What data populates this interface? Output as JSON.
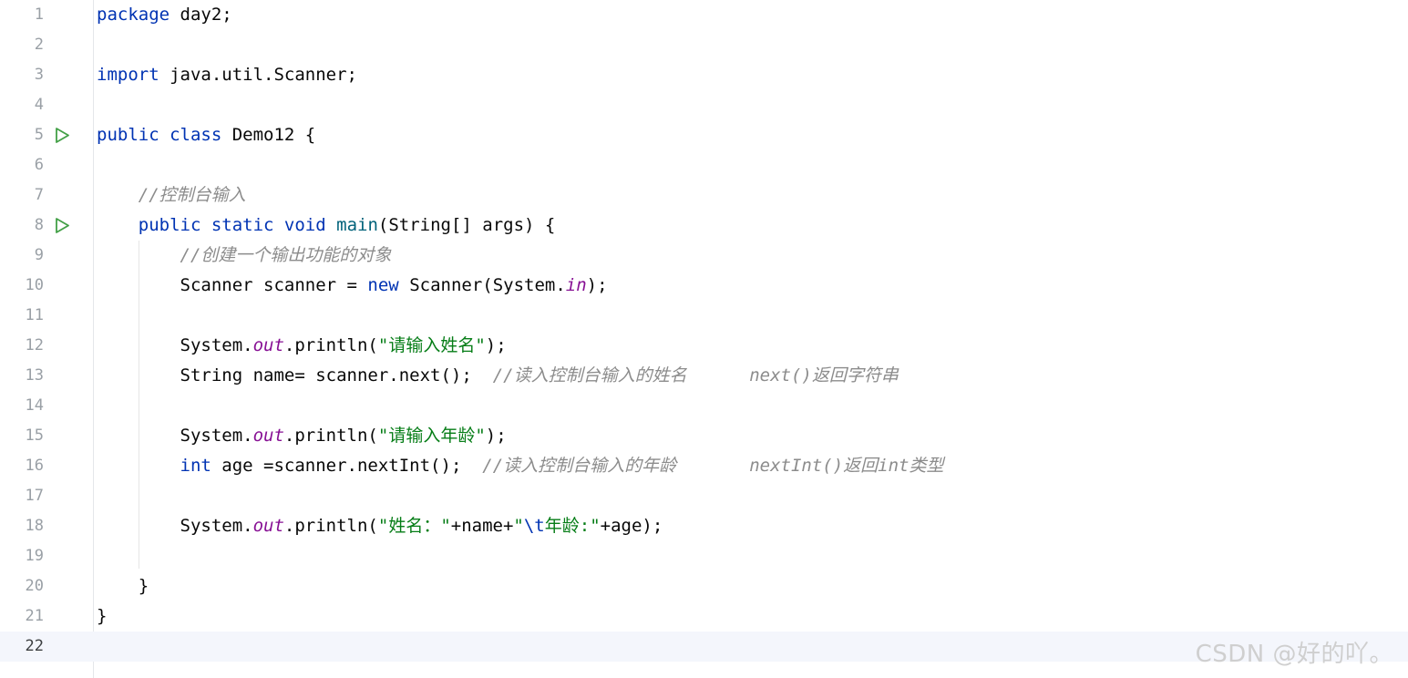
{
  "editor": {
    "lines": [
      {
        "num": "1",
        "tokens": [
          {
            "t": "kw",
            "v": "package"
          },
          {
            "t": "p",
            "v": " day2;"
          }
        ]
      },
      {
        "num": "2",
        "tokens": []
      },
      {
        "num": "3",
        "tokens": [
          {
            "t": "kw",
            "v": "import"
          },
          {
            "t": "p",
            "v": " java.util.Scanner;"
          }
        ]
      },
      {
        "num": "4",
        "tokens": []
      },
      {
        "num": "5",
        "run": true,
        "tokens": [
          {
            "t": "kw",
            "v": "public class"
          },
          {
            "t": "p",
            "v": " Demo12 {"
          }
        ]
      },
      {
        "num": "6",
        "tokens": []
      },
      {
        "num": "7",
        "tokens": [
          {
            "t": "p",
            "v": "    "
          },
          {
            "t": "cmt",
            "v": "//控制台输入"
          }
        ]
      },
      {
        "num": "8",
        "run": true,
        "tokens": [
          {
            "t": "p",
            "v": "    "
          },
          {
            "t": "kw",
            "v": "public static void"
          },
          {
            "t": "p",
            "v": " "
          },
          {
            "t": "fn",
            "v": "main"
          },
          {
            "t": "p",
            "v": "(String[] args) {"
          }
        ]
      },
      {
        "num": "9",
        "tokens": [
          {
            "t": "p",
            "v": "        "
          },
          {
            "t": "cmt",
            "v": "//创建一个输出功能的对象"
          }
        ]
      },
      {
        "num": "10",
        "tokens": [
          {
            "t": "p",
            "v": "        Scanner scanner = "
          },
          {
            "t": "kw",
            "v": "new"
          },
          {
            "t": "p",
            "v": " Scanner(System."
          },
          {
            "t": "field",
            "v": "in"
          },
          {
            "t": "p",
            "v": ");"
          }
        ]
      },
      {
        "num": "11",
        "tokens": []
      },
      {
        "num": "12",
        "tokens": [
          {
            "t": "p",
            "v": "        System."
          },
          {
            "t": "field",
            "v": "out"
          },
          {
            "t": "p",
            "v": ".println("
          },
          {
            "t": "str",
            "v": "\"请输入姓名\""
          },
          {
            "t": "p",
            "v": ");"
          }
        ]
      },
      {
        "num": "13",
        "tokens": [
          {
            "t": "p",
            "v": "        String name= scanner.next();  "
          },
          {
            "t": "cmt",
            "v": "//读入控制台输入的姓名      next()返回字符串"
          }
        ]
      },
      {
        "num": "14",
        "tokens": []
      },
      {
        "num": "15",
        "tokens": [
          {
            "t": "p",
            "v": "        System."
          },
          {
            "t": "field",
            "v": "out"
          },
          {
            "t": "p",
            "v": ".println("
          },
          {
            "t": "str",
            "v": "\"请输入年龄\""
          },
          {
            "t": "p",
            "v": ");"
          }
        ]
      },
      {
        "num": "16",
        "tokens": [
          {
            "t": "p",
            "v": "        "
          },
          {
            "t": "kw",
            "v": "int"
          },
          {
            "t": "p",
            "v": " age =scanner.nextInt();  "
          },
          {
            "t": "cmt",
            "v": "//读入控制台输入的年龄       nextInt()返回int类型"
          }
        ]
      },
      {
        "num": "17",
        "tokens": []
      },
      {
        "num": "18",
        "tokens": [
          {
            "t": "p",
            "v": "        System."
          },
          {
            "t": "field",
            "v": "out"
          },
          {
            "t": "p",
            "v": ".println("
          },
          {
            "t": "str",
            "v": "\"姓名：\""
          },
          {
            "t": "p",
            "v": "+name+"
          },
          {
            "t": "str",
            "v": "\""
          },
          {
            "t": "kw",
            "v": "\\t"
          },
          {
            "t": "str",
            "v": "年龄:\""
          },
          {
            "t": "p",
            "v": "+age);"
          }
        ]
      },
      {
        "num": "19",
        "tokens": []
      },
      {
        "num": "20",
        "tokens": [
          {
            "t": "p",
            "v": "    }"
          }
        ]
      },
      {
        "num": "21",
        "tokens": [
          {
            "t": "p",
            "v": "}"
          }
        ]
      },
      {
        "num": "22",
        "current": true,
        "tokens": []
      }
    ],
    "run_icon": "run-triangle-icon"
  },
  "watermark": "CSDN @好的吖。",
  "colors": {
    "keyword": "#0033b3",
    "string": "#067d17",
    "field": "#871094",
    "method": "#00627a",
    "comment": "#8c8c8c",
    "run_icon": "#43a047",
    "current_line_bg": "#f4f6fc"
  }
}
